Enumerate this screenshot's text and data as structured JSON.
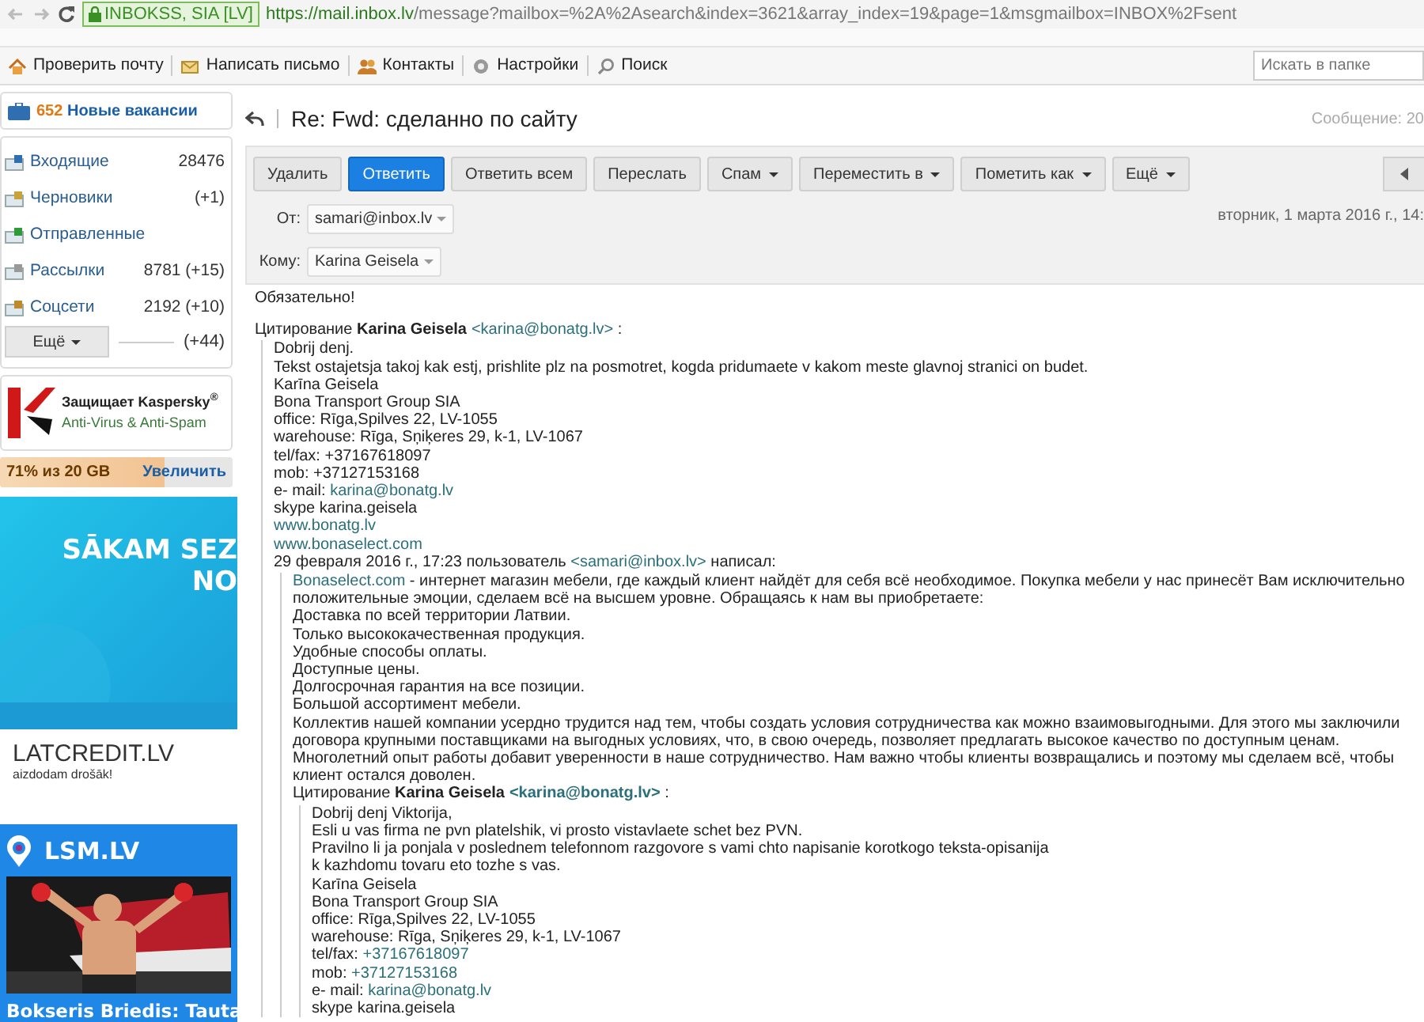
{
  "browser": {
    "cert": "INBOKSS, SIA [LV]",
    "url_host": "https://mail.inbox.lv",
    "url_path": "/message?mailbox=%2A%2Asearch&index=3621&array_index=19&page=1&msgmailbox=INBOX%2Fsent"
  },
  "toolbar": {
    "items": [
      {
        "label": "Проверить почту",
        "kind": "home"
      },
      {
        "label": "Написать письмо",
        "kind": "compose"
      },
      {
        "label": "Контакты",
        "kind": "contacts"
      },
      {
        "label": "Настройки",
        "kind": "settings"
      },
      {
        "label": "Поиск",
        "kind": "search"
      }
    ],
    "search_placeholder": "Искать в папке"
  },
  "sidebar": {
    "jobs": {
      "count": "652",
      "label": "Новые вакансии"
    },
    "folders": [
      {
        "name": "Входящие",
        "count": "28476",
        "kind": "inbox"
      },
      {
        "name": "Черновики",
        "count": "(+1)",
        "kind": "drafts"
      },
      {
        "name": "Отправленные",
        "kind": "sent"
      },
      {
        "name": "Рассылки",
        "count": "8781 (+15)",
        "kind": "lists"
      },
      {
        "name": "Соцсети",
        "count": "2192 (+10)",
        "kind": "social"
      }
    ],
    "more_button": "Ещё",
    "more_count": "(+44)",
    "antivirus": {
      "title": "Защищает Kaspersky$^{®}$",
      "subtitle": "Anti-Virus & Anti-Spam"
    },
    "storage": {
      "text": "71% из 20 GB",
      "level": 0.71,
      "button": "Увеличить"
    },
    "ad_credit": {
      "headline": [
        "SĀKAM SEZ",
        "NO"
      ],
      "brand": "LATCREDIT.LV",
      "tagline": "aizdodam drošāk!"
    },
    "ad_news": {
      "brand": "LSM.LV",
      "headline": "Bokseris Briedis: Tauta"
    }
  },
  "message": {
    "subject": "Re: Fwd: сделанно по сайту",
    "counter": "Сообщение: 20",
    "actions": [
      {
        "label": "Удалить",
        "primary": false,
        "dropdown": false
      },
      {
        "label": "Ответить",
        "primary": true,
        "dropdown": false
      },
      {
        "label": "Ответить всем",
        "primary": false,
        "dropdown": false
      },
      {
        "label": "Переслать",
        "primary": false,
        "dropdown": false
      },
      {
        "label": "Спам",
        "primary": false,
        "dropdown": true
      },
      {
        "label": "Переместить в",
        "primary": false,
        "dropdown": true
      },
      {
        "label": "Пометить как",
        "primary": false,
        "dropdown": true
      },
      {
        "label": "Ещё",
        "primary": false,
        "dropdown": true
      }
    ],
    "from_label": "От:",
    "from": "samari@inbox.lv",
    "date": "вторник, 1 марта 2016 г., 14:",
    "to_label": "Кому:",
    "to": "Karina Geisela",
    "body": [
      {
        "kind": "para",
        "segments": [
          {
            "kind": "plain",
            "text": "Обязательно!"
          }
        ]
      },
      {
        "kind": "line",
        "segments": [
          {
            "kind": "plain",
            "text": "Цитирование "
          },
          {
            "kind": "bold",
            "text": "Karina Geisela"
          },
          {
            "kind": "link",
            "text": "<karina@bonatg.lv>"
          },
          {
            "kind": "plain",
            "text": " :"
          }
        ]
      },
      {
        "kind": "quote",
        "items": [
          {
            "kind": "line",
            "segments": [
              {
                "kind": "plain",
                "text": "Dobrij denj."
              }
            ]
          },
          {
            "kind": "line",
            "segments": [
              {
                "kind": "plain",
                "text": "Tekst ostajetsja takoj kak estj, prishlite plz na posmotret, kogda pridumaete v kakom meste glavnoj stranici on budet."
              }
            ]
          },
          {
            "kind": "line",
            "segments": [
              {
                "kind": "plain",
                "text": "Karīna Geisela"
              }
            ]
          },
          {
            "kind": "line",
            "segments": [
              {
                "kind": "plain",
                "text": "Bona Transport Group SIA"
              }
            ]
          },
          {
            "kind": "line",
            "segments": [
              {
                "kind": "plain",
                "text": "office: Rīga,Spilves 22, LV-1055"
              }
            ]
          },
          {
            "kind": "line",
            "segments": [
              {
                "kind": "plain",
                "text": "warehouse: Rīga, Sņiķeres 29, k-1, LV-1067"
              }
            ]
          },
          {
            "kind": "line",
            "segments": [
              {
                "kind": "plain",
                "text": "tel/fax: +37167618097"
              }
            ]
          },
          {
            "kind": "line",
            "segments": [
              {
                "kind": "plain",
                "text": "mob: +37127153168"
              }
            ]
          },
          {
            "kind": "line",
            "segments": [
              {
                "kind": "plain",
                "text": "e- mail: "
              },
              {
                "kind": "link",
                "text": "karina@bonatg.lv"
              }
            ]
          },
          {
            "kind": "line",
            "segments": [
              {
                "kind": "plain",
                "text": "skype karina.geisela"
              }
            ]
          },
          {
            "kind": "line",
            "segments": [
              {
                "kind": "link",
                "text": "www.bonatg.lv"
              }
            ]
          },
          {
            "kind": "line",
            "segments": [
              {
                "kind": "link",
                "text": "www.bonaselect.com"
              }
            ]
          },
          {
            "kind": "line",
            "segments": [
              {
                "kind": "plain",
                "text": "29 февраля 2016 г., 17:23 пользователь "
              },
              {
                "kind": "link",
                "text": "<samari@inbox.lv>"
              },
              {
                "kind": "plain",
                "text": " написал:"
              }
            ]
          },
          {
            "kind": "quote",
            "items": [
              {
                "kind": "line",
                "segments": [
                  {
                    "kind": "link",
                    "text": "Bonaselect.com"
                  },
                  {
                    "kind": "plain",
                    "text": " - интернет магазин мебели, где каждый клиент найдёт для себя всё необходимое. Покупка мебели у нас принесёт Вам исключительно положительные эмоции, сделаем всё на высшем уровне. Обращаясь к нам вы приобретаете:"
                  }
                ]
              },
              {
                "kind": "line",
                "segments": [
                  {
                    "kind": "plain",
                    "text": "Доставка по всей территории Латвии."
                  }
                ]
              },
              {
                "kind": "line",
                "segments": [
                  {
                    "kind": "plain",
                    "text": "Только высококачественная продукция."
                  }
                ]
              },
              {
                "kind": "line",
                "segments": [
                  {
                    "kind": "plain",
                    "text": "Удобные способы оплаты."
                  }
                ]
              },
              {
                "kind": "line",
                "segments": [
                  {
                    "kind": "plain",
                    "text": "Доступные цены."
                  }
                ]
              },
              {
                "kind": "line",
                "segments": [
                  {
                    "kind": "plain",
                    "text": "Долгосрочная гарантия на все позиции."
                  }
                ]
              },
              {
                "kind": "line",
                "segments": [
                  {
                    "kind": "plain",
                    "text": "Большой ассортимент мебели."
                  }
                ]
              },
              {
                "kind": "line",
                "segments": [
                  {
                    "kind": "plain",
                    "text": "Коллектив нашей компании усердно трудится над тем, чтобы создать условия сотрудничества как можно взаимовыгодными. Для этого мы заключили договора крупными поставщиками на выгодных условиях, что, в свою очередь, позволяет предлагать высокое качество по доступным ценам. Многолетний опыт работы добавит уверенности в наше сотрудничество. Нам важно чтобы клиенты возвращались и поэтому мы сделаем всё, чтобы клиент остался доволен."
                  }
                ]
              },
              {
                "kind": "line",
                "segments": [
                  {
                    "kind": "plain",
                    "text": "Цитирование "
                  },
                  {
                    "kind": "bold",
                    "text": "Karina Geisela"
                  },
                  {
                    "kind": "bold-link",
                    "text": "<karina@bonatg.lv>"
                  },
                  {
                    "kind": "plain",
                    "text": " :"
                  }
                ]
              },
              {
                "kind": "quote",
                "items": [
                  {
                    "kind": "line",
                    "segments": [
                      {
                        "kind": "plain",
                        "text": "Dobrij denj Viktorija,"
                      }
                    ]
                  },
                  {
                    "kind": "line",
                    "segments": [
                      {
                        "kind": "plain",
                        "text": "Esli u vas firma ne pvn platelshik, vi prosto vistavlaete schet bez PVN."
                      }
                    ]
                  },
                  {
                    "kind": "line",
                    "segments": [
                      {
                        "kind": "plain",
                        "text": "Pravilno li ja ponjala v poslednem telefonnom razgovore s vami chto napisanie korotkogo teksta-opisanija"
                      }
                    ]
                  },
                  {
                    "kind": "line",
                    "segments": [
                      {
                        "kind": "plain",
                        "text": "k kazhdomu tovaru eto tozhe s vas."
                      }
                    ]
                  },
                  {
                    "kind": "line",
                    "segments": [
                      {
                        "kind": "plain",
                        "text": "Karīna Geisela"
                      }
                    ]
                  },
                  {
                    "kind": "line",
                    "segments": [
                      {
                        "kind": "plain",
                        "text": "Bona Transport Group SIA"
                      }
                    ]
                  },
                  {
                    "kind": "line",
                    "segments": [
                      {
                        "kind": "plain",
                        "text": "office: Rīga,Spilves 22, LV-1055"
                      }
                    ]
                  },
                  {
                    "kind": "line",
                    "segments": [
                      {
                        "kind": "plain",
                        "text": "warehouse: Rīga, Sņiķeres 29, k-1, LV-1067"
                      }
                    ]
                  },
                  {
                    "kind": "line",
                    "segments": [
                      {
                        "kind": "plain",
                        "text": "tel/fax: "
                      },
                      {
                        "kind": "link",
                        "text": "+37167618097"
                      }
                    ]
                  },
                  {
                    "kind": "line",
                    "segments": [
                      {
                        "kind": "plain",
                        "text": "mob: "
                      },
                      {
                        "kind": "link",
                        "text": "+37127153168"
                      }
                    ]
                  },
                  {
                    "kind": "line",
                    "segments": [
                      {
                        "kind": "plain",
                        "text": "e- mail: "
                      },
                      {
                        "kind": "link",
                        "text": "karina@bonatg.lv"
                      }
                    ]
                  },
                  {
                    "kind": "line",
                    "segments": [
                      {
                        "kind": "plain",
                        "text": "skype karina.geisela"
                      }
                    ]
                  }
                ]
              }
            ]
          }
        ]
      }
    ]
  }
}
